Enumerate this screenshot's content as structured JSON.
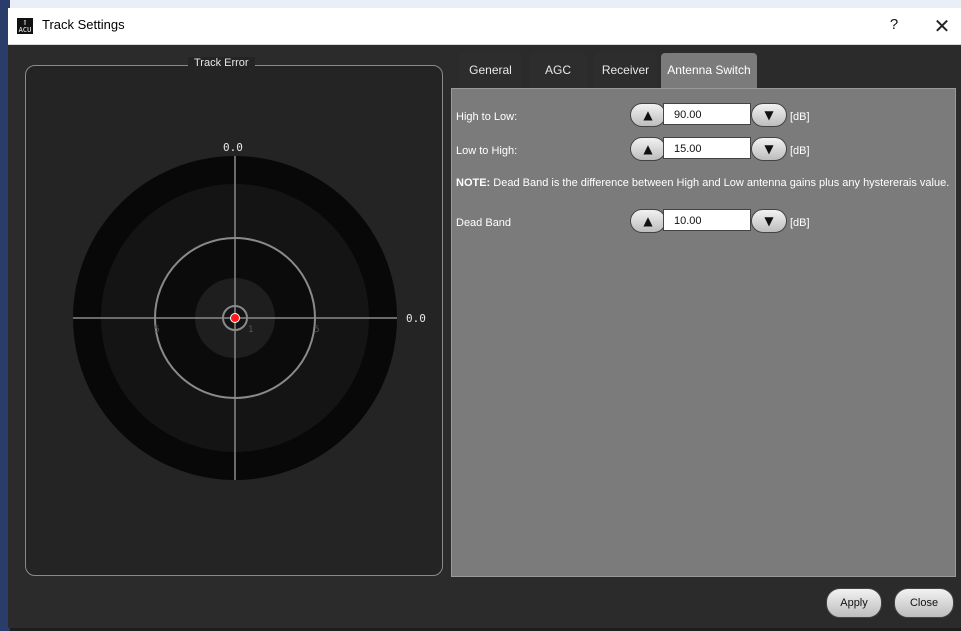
{
  "window": {
    "title": "Track Settings",
    "help_label": "?",
    "close_label": "✕"
  },
  "track_error": {
    "title": "Track Error",
    "top_value": "0.0",
    "right_value": "0.0",
    "ring_labels": [
      "5",
      "1",
      "5"
    ]
  },
  "tabs": [
    {
      "label": "General",
      "active": false
    },
    {
      "label": "AGC",
      "active": false
    },
    {
      "label": "Receiver",
      "active": false
    },
    {
      "label": "Antenna Switch",
      "active": true
    }
  ],
  "antenna_switch": {
    "high_to_low": {
      "label": "High to Low:",
      "value": "90.00",
      "unit": "[dB]"
    },
    "low_to_high": {
      "label": " Low to High:",
      "value": "15.00",
      "unit": "[dB]"
    },
    "note_prefix": "NOTE:",
    "note_text": " Dead Band is the difference between High and Low antenna gains plus any hystererais value.",
    "dead_band": {
      "label": "Dead Band",
      "value": "10.00",
      "unit": "[dB]"
    }
  },
  "buttons": {
    "apply": "Apply",
    "close": "Close"
  },
  "icons": {
    "app": "app-icon",
    "up": "▲",
    "down": "▼"
  },
  "colors": {
    "marker": "#ff1b1b",
    "panel": "#7b7b7b"
  }
}
